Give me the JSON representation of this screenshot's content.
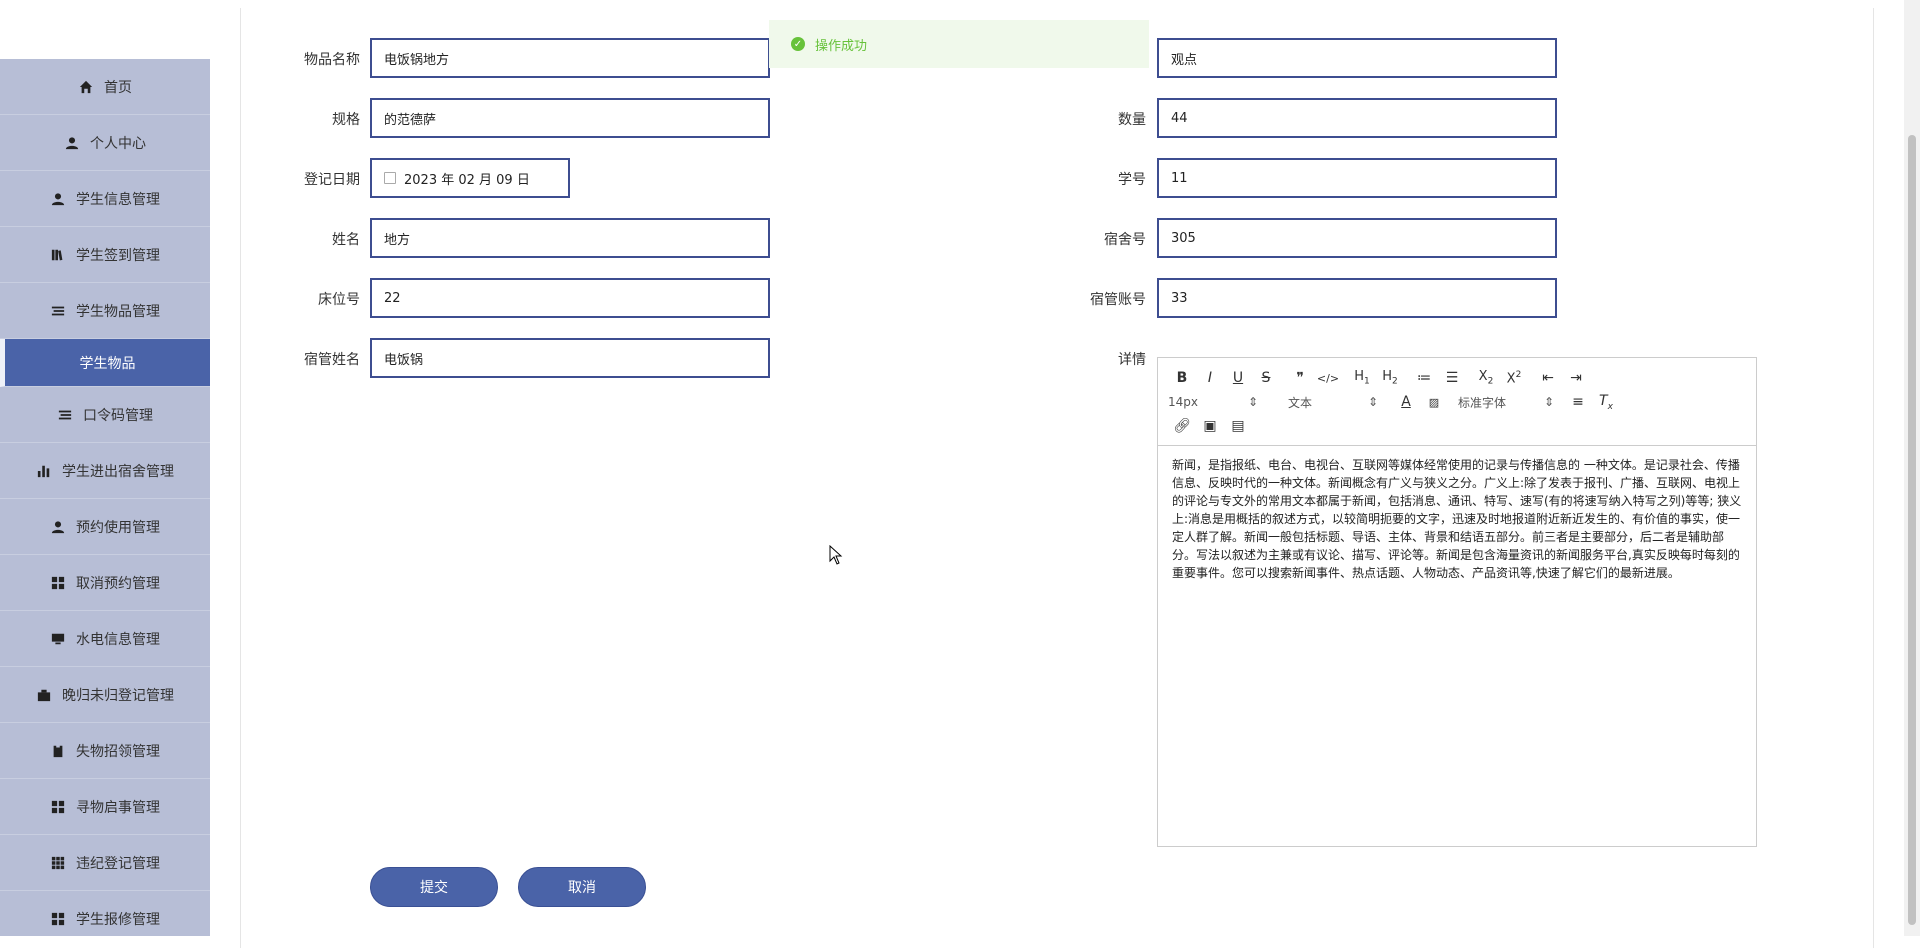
{
  "sidebar": {
    "items": [
      {
        "label": "首页",
        "icon": "home-icon"
      },
      {
        "label": "个人中心",
        "icon": "user-icon"
      },
      {
        "label": "学生信息管理",
        "icon": "user-icon"
      },
      {
        "label": "学生签到管理",
        "icon": "book-icon"
      },
      {
        "label": "学生物品管理",
        "icon": "list-icon"
      },
      {
        "label": "学生物品",
        "icon": "",
        "active": true
      },
      {
        "label": "口令码管理",
        "icon": "list-icon"
      },
      {
        "label": "学生进出宿舍管理",
        "icon": "bar-chart-icon"
      },
      {
        "label": "预约使用管理",
        "icon": "user-icon"
      },
      {
        "label": "取消预约管理",
        "icon": "grid-icon"
      },
      {
        "label": "水电信息管理",
        "icon": "monitor-icon"
      },
      {
        "label": "晚归未归登记管理",
        "icon": "briefcase-icon"
      },
      {
        "label": "失物招领管理",
        "icon": "clipboard-icon"
      },
      {
        "label": "寻物启事管理",
        "icon": "grid-icon"
      },
      {
        "label": "违纪登记管理",
        "icon": "apps-icon"
      },
      {
        "label": "学生报修管理",
        "icon": "grid-icon"
      }
    ]
  },
  "toast": {
    "message": "操作成功",
    "color": "#67c23a"
  },
  "form": {
    "item_name_label": "物品名称",
    "item_name_value": "电饭锅地方",
    "viewpoint_value": "观点",
    "spec_label": "规格",
    "spec_value": "的范德萨",
    "quantity_label": "数量",
    "quantity_value": "44",
    "date_label": "登记日期",
    "date_value": "2023 年 02 月 09 日",
    "student_no_label": "学号",
    "student_no_value": "11",
    "name_label": "姓名",
    "name_value": "地方",
    "dorm_label": "宿舍号",
    "dorm_value": "305",
    "bed_label": "床位号",
    "bed_value": "22",
    "manager_account_label": "宿管账号",
    "manager_account_value": "33",
    "manager_name_label": "宿管姓名",
    "manager_name_value": "电饭锅",
    "detail_label": "详情"
  },
  "editor": {
    "font_size": "14px",
    "block_type": "文本",
    "font_family": "标准字体",
    "content": "新闻，是指报纸、电台、电视台、互联网等媒体经常使用的记录与传播信息的 一种文体。是记录社会、传播信息、反映时代的一种文体。新闻概念有广义与狭义之分。广义上:除了发表于报刊、广播、互联网、电视上的评论与专文外的常用文本都属于新闻，包括消息、通讯、特写、速写(有的将速写纳入特写之列)等等; 狭义上:消息是用概括的叙述方式，以较简明扼要的文字，迅速及时地报道附近新近发生的、有价值的事实，使一定人群了解。新闻一般包括标题、导语、主体、背景和结语五部分。前三者是主要部分，后二者是辅助部分。写法以叙述为主兼或有议论、描写、评论等。新闻是包含海量资讯的新闻服务平台,真实反映每时每刻的重要事件。您可以搜索新闻事件、热点话题、人物动态、产品资讯等,快速了解它们的最新进展。"
  },
  "buttons": {
    "submit": "提交",
    "cancel": "取消"
  },
  "colors": {
    "accent": "#4a63a8",
    "sidebar_bg": "#b7bed6",
    "input_border": "#3d4d90"
  }
}
